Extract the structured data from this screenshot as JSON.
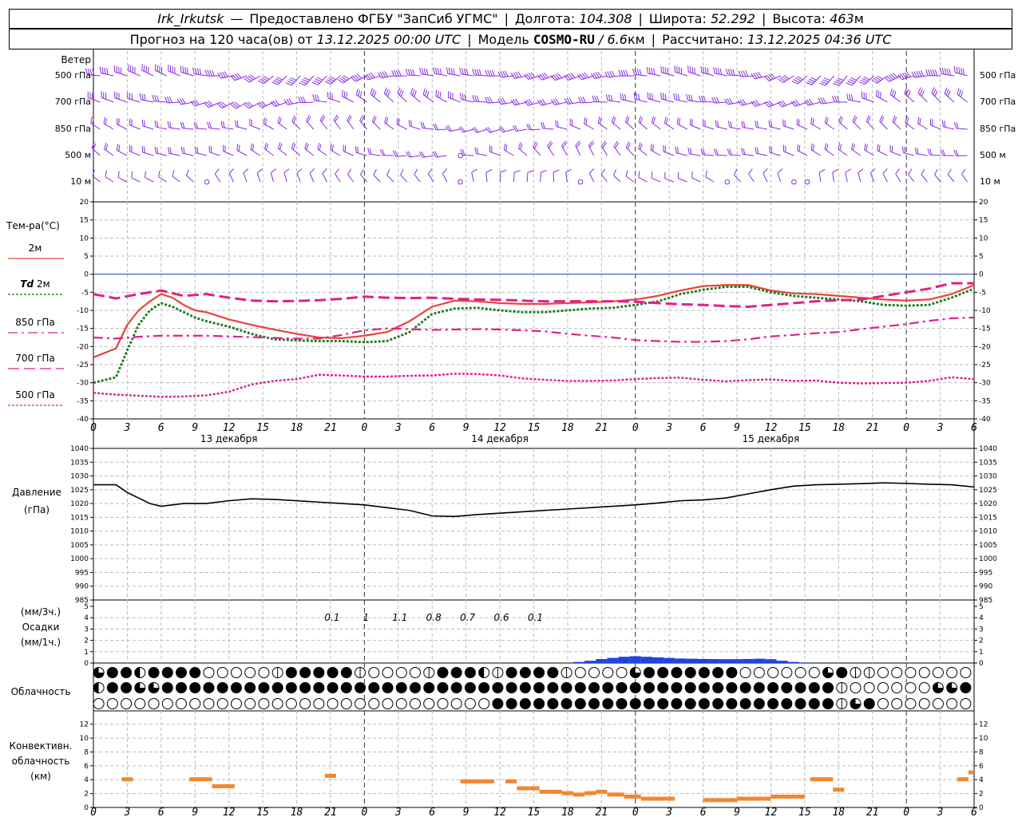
{
  "header": {
    "station": "Irk_Irkutsk",
    "dash": "—",
    "provider": "Предоставлено ФГБУ \"ЗапСиб УГМС\"",
    "lon_label": "Долгота:",
    "lon_value": "104.308",
    "lat_label": "Широта:",
    "lat_value": "52.292",
    "alt_label": "Высота:",
    "alt_value": "463",
    "alt_unit": "м",
    "forecast_label": "Прогноз на 120 часа(ов) от",
    "forecast_time": "13.12.2025 00:00 UTC",
    "model_label": "Модель",
    "model_name": "COSMO-RU",
    "model_res": "/ 6.6",
    "model_unit": "км",
    "calc_label": "Рассчитано:",
    "calc_time": "13.12.2025 04:36 UTC"
  },
  "wind_panel": {
    "title": "Ветер",
    "levels": [
      "500 гПа",
      "700 гПа",
      "850 гПа",
      "500 м",
      "10 м"
    ]
  },
  "temp_panel": {
    "title": "Тем-ра(°С)",
    "legend": [
      {
        "label": "2м",
        "color": "#e8443a",
        "dash": ""
      },
      {
        "label_a": "Td",
        "label_b": "2м",
        "color": "#1a7a1a",
        "dash": "3,2"
      },
      {
        "label": "850 гПа",
        "color": "#e0208a",
        "dash": "12,5,3,5"
      },
      {
        "label": "700 гПа",
        "color": "#e0208a",
        "dash": "14,6"
      },
      {
        "label": "500 гПа",
        "color": "#e0208a",
        "dash": "3,2"
      }
    ]
  },
  "pressure_panel": {
    "title": "Давление",
    "unit": "(гПа)"
  },
  "precip_panel": {
    "unit3": "(мм/3ч.)",
    "title": "Осадки",
    "unit1": "(мм/1ч.)",
    "labels": [
      {
        "t": 21,
        "v": "0.1"
      },
      {
        "t": 24,
        "v": "1"
      },
      {
        "t": 27,
        "v": "1.1"
      },
      {
        "t": 30,
        "v": "0.8"
      },
      {
        "t": 33,
        "v": "0.7"
      },
      {
        "t": 36,
        "v": "0.6"
      },
      {
        "t": 39,
        "v": "0.1"
      }
    ]
  },
  "cloud_panel": {
    "title": "Облачность"
  },
  "conv_panel": {
    "title1": "Конвективн.",
    "title2": "облачность",
    "unit": "(км)"
  },
  "days": [
    {
      "t": 12,
      "label": "13 декабря"
    },
    {
      "t": 36,
      "label": "14 декабря"
    },
    {
      "t": 60,
      "label": "15 декабря"
    }
  ],
  "chart_data": {
    "type": "line",
    "x_label_hours": [
      0,
      3,
      6,
      9,
      12,
      15,
      18,
      21,
      0,
      3,
      6,
      9,
      12,
      15,
      18,
      21,
      0,
      3,
      6,
      9,
      12,
      15,
      18,
      21,
      0,
      3,
      6
    ],
    "x_range_hours": [
      0,
      78
    ],
    "temperature": {
      "ylim": [
        -40,
        20
      ],
      "yticks": [
        20,
        15,
        10,
        5,
        0,
        -5,
        -10,
        -15,
        -20,
        -25,
        -30,
        -35,
        -40
      ],
      "series": [
        {
          "name": "2м",
          "color": "#e8443a",
          "x": [
            0,
            2,
            3,
            4,
            5,
            6,
            7,
            8,
            9,
            10,
            12,
            14,
            16,
            18,
            20,
            22,
            24,
            26,
            28,
            30,
            32,
            34,
            36,
            38,
            40,
            42,
            44,
            46,
            48,
            50,
            52,
            54,
            56,
            58,
            60,
            62,
            64,
            66,
            68,
            70,
            72,
            74,
            76,
            78
          ],
          "y": [
            -23,
            -20.5,
            -14,
            -10,
            -7.5,
            -5.5,
            -6.5,
            -8.5,
            -10,
            -10.5,
            -12.5,
            -14,
            -15.3,
            -16.5,
            -17.5,
            -17.7,
            -17,
            -16,
            -13,
            -9,
            -7.3,
            -7.5,
            -8,
            -8.2,
            -8.2,
            -8,
            -7.8,
            -7.5,
            -7,
            -6,
            -4.5,
            -3.3,
            -3,
            -3,
            -4.5,
            -5.3,
            -5.5,
            -6,
            -6.5,
            -7,
            -7.3,
            -7,
            -5.5,
            -3
          ]
        },
        {
          "name": "Td 2м",
          "color": "#1a7a1a",
          "x": [
            0,
            2,
            3,
            4,
            5,
            6,
            7,
            8,
            9,
            10,
            12,
            14,
            16,
            18,
            20,
            22,
            24,
            26,
            28,
            30,
            32,
            34,
            36,
            38,
            40,
            42,
            44,
            46,
            48,
            50,
            52,
            54,
            56,
            58,
            60,
            62,
            64,
            66,
            68,
            70,
            72,
            74,
            76,
            78
          ],
          "y": [
            -30,
            -28.5,
            -21,
            -14,
            -10,
            -8,
            -9,
            -10.5,
            -12,
            -13,
            -14.5,
            -16.5,
            -18,
            -18.3,
            -18.5,
            -18.5,
            -18.8,
            -18.5,
            -16,
            -11,
            -9.5,
            -9.3,
            -10,
            -10.5,
            -10.5,
            -10,
            -9.5,
            -9.3,
            -8.5,
            -7.5,
            -5.5,
            -4.3,
            -3.5,
            -3.5,
            -5,
            -6,
            -6.5,
            -7,
            -7.5,
            -8.5,
            -8.7,
            -8.5,
            -6.5,
            -4
          ]
        },
        {
          "name": "850 гПа",
          "color": "#e0208a",
          "x": [
            0,
            2,
            4,
            6,
            8,
            10,
            12,
            14,
            16,
            18,
            20,
            22,
            24,
            26,
            28,
            30,
            32,
            34,
            36,
            38,
            40,
            42,
            44,
            46,
            48,
            50,
            52,
            54,
            56,
            58,
            60,
            62,
            64,
            66,
            68,
            70,
            72,
            74,
            76,
            78
          ],
          "y": [
            -17.5,
            -17.8,
            -17.3,
            -17,
            -17,
            -17,
            -17.2,
            -17.4,
            -17.6,
            -17.8,
            -17.8,
            -16.8,
            -15.5,
            -15,
            -15.2,
            -15.4,
            -15.3,
            -15.2,
            -15.3,
            -15.5,
            -15.8,
            -16.5,
            -17,
            -17.5,
            -18.2,
            -18.5,
            -18.7,
            -18.7,
            -18.5,
            -18,
            -17.2,
            -16.8,
            -16.3,
            -16,
            -15.2,
            -14.5,
            -13.8,
            -12.9,
            -12.2,
            -12
          ]
        },
        {
          "name": "700 гПа",
          "color": "#e0208a",
          "x": [
            0,
            2,
            4,
            6,
            8,
            10,
            12,
            14,
            16,
            18,
            20,
            22,
            24,
            26,
            28,
            30,
            32,
            34,
            36,
            38,
            40,
            42,
            44,
            46,
            48,
            50,
            52,
            54,
            56,
            58,
            60,
            62,
            64,
            66,
            68,
            70,
            72,
            74,
            76,
            78
          ],
          "y": [
            -5.5,
            -6.7,
            -5.5,
            -4.5,
            -6,
            -5.5,
            -6.5,
            -7.3,
            -7.5,
            -7.4,
            -7.2,
            -6.8,
            -6.2,
            -6.5,
            -6.6,
            -6.5,
            -6.8,
            -7,
            -7.1,
            -7.3,
            -7.5,
            -7.5,
            -7.5,
            -7.5,
            -7.6,
            -8,
            -8.3,
            -8.5,
            -8.8,
            -9,
            -8.5,
            -8,
            -7.5,
            -7.2,
            -7,
            -6,
            -5,
            -4,
            -2.5,
            -2.5
          ]
        },
        {
          "name": "500 гПа",
          "color": "#e0208a",
          "x": [
            0,
            2,
            4,
            6,
            8,
            10,
            12,
            14,
            16,
            18,
            20,
            22,
            24,
            26,
            28,
            30,
            32,
            34,
            36,
            38,
            40,
            42,
            44,
            46,
            48,
            50,
            52,
            54,
            56,
            58,
            60,
            62,
            64,
            66,
            68,
            70,
            72,
            74,
            76,
            78
          ],
          "y": [
            -32.8,
            -33.3,
            -33.6,
            -33.9,
            -33.8,
            -33.5,
            -32.5,
            -30.5,
            -29.5,
            -29,
            -27.8,
            -28,
            -28.3,
            -28.3,
            -28.1,
            -28,
            -27.5,
            -27.6,
            -28,
            -28.8,
            -29.2,
            -29.5,
            -29.5,
            -29.4,
            -29,
            -28.7,
            -28.6,
            -29.2,
            -29.6,
            -29.3,
            -29.1,
            -29.5,
            -29.4,
            -30,
            -30.2,
            -30.1,
            -30,
            -29.5,
            -28.5,
            -29
          ]
        }
      ]
    },
    "pressure": {
      "ylim": [
        985,
        1040
      ],
      "yticks": [
        1040,
        1035,
        1030,
        1025,
        1020,
        1015,
        1010,
        1005,
        1000,
        995,
        990,
        985
      ],
      "series": [
        {
          "name": "pressure",
          "color": "#000000",
          "x": [
            0,
            2,
            3,
            4,
            5,
            6,
            8,
            10,
            12,
            14,
            16,
            18,
            20,
            22,
            24,
            26,
            28,
            30,
            32,
            34,
            36,
            38,
            40,
            42,
            44,
            46,
            48,
            50,
            52,
            54,
            56,
            58,
            60,
            62,
            64,
            66,
            68,
            70,
            72,
            74,
            76,
            78
          ],
          "y": [
            1026.8,
            1026.8,
            1024,
            1022,
            1020,
            1019,
            1020,
            1020,
            1021,
            1021.7,
            1021.5,
            1021,
            1020.5,
            1020,
            1019.5,
            1018.5,
            1017.5,
            1015.5,
            1015.3,
            1016,
            1016.5,
            1017,
            1017.5,
            1018,
            1018.5,
            1019,
            1019.5,
            1020.2,
            1021,
            1021.3,
            1022,
            1023.5,
            1025,
            1026.3,
            1026.8,
            1027,
            1027.2,
            1027.5,
            1027.3,
            1027,
            1026.8,
            1026
          ]
        }
      ]
    },
    "precipitation": {
      "ylim": [
        0,
        5
      ],
      "yticks": [
        5,
        4,
        3,
        2,
        1,
        0
      ],
      "series": [
        {
          "name": "precip",
          "color": "#2244dd",
          "x": [
            43,
            44,
            45,
            46,
            47,
            48,
            49,
            50,
            51,
            52,
            53,
            54,
            55,
            56,
            57,
            58,
            59,
            60,
            61,
            62,
            63
          ],
          "y": [
            0.1,
            0.2,
            0.35,
            0.45,
            0.55,
            0.6,
            0.55,
            0.5,
            0.45,
            0.4,
            0.38,
            0.36,
            0.35,
            0.34,
            0.34,
            0.36,
            0.38,
            0.34,
            0.2,
            0.1,
            0.05
          ]
        }
      ]
    },
    "cloudiness": {
      "rows": 3,
      "row1": "3442444400000144444100001444214444100003444444400000034110000000",
      "row2": "2443344444444444444444444444444444444444444444444444441000000334",
      "row3": "0000000000000000000000000000044444444444444444444444441340000000"
    },
    "convective": {
      "ylim": [
        0,
        13
      ],
      "yticks": [
        12,
        10,
        8,
        6,
        4,
        2,
        0
      ],
      "segments": [
        [
          2.5,
          3.5,
          4
        ],
        [
          8.5,
          10.5,
          4
        ],
        [
          10.5,
          12.5,
          3
        ],
        [
          20.5,
          21.5,
          4.5
        ],
        [
          32.5,
          35.5,
          3.7
        ],
        [
          36.5,
          37.5,
          3.7
        ],
        [
          37.5,
          39.5,
          2.7
        ],
        [
          39.5,
          41.5,
          2.2
        ],
        [
          41.5,
          42.5,
          2.0
        ],
        [
          42.5,
          43.5,
          1.8
        ],
        [
          43.5,
          44.5,
          2.0
        ],
        [
          44.5,
          45.5,
          2.2
        ],
        [
          45.5,
          47,
          1.8
        ],
        [
          47,
          48.5,
          1.5
        ],
        [
          48.5,
          51.5,
          1.2
        ],
        [
          54,
          57,
          1.0
        ],
        [
          57,
          60,
          1.2
        ],
        [
          60,
          63,
          1.5
        ],
        [
          63.5,
          65.5,
          4.0
        ],
        [
          65.5,
          66.5,
          2.5
        ],
        [
          76.5,
          77.5,
          4.0
        ],
        [
          77.5,
          78,
          5.0
        ]
      ]
    }
  }
}
